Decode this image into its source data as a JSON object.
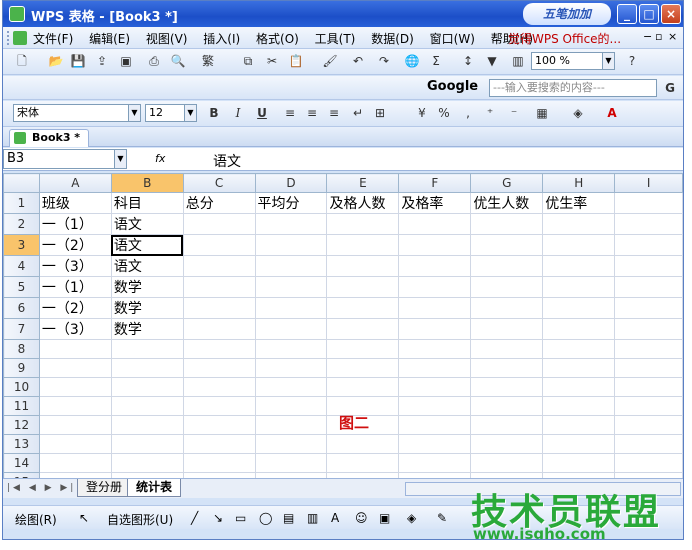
{
  "window": {
    "title": "WPS 表格 - [Book3 *]",
    "logo_text": "五笔加加",
    "buttons": [
      "_",
      "□",
      "×"
    ]
  },
  "menubar": {
    "items": [
      "文件(F)",
      "编辑(E)",
      "视图(V)",
      "插入(I)",
      "格式(O)",
      "工具(T)",
      "数据(D)",
      "窗口(W)",
      "帮助(H)"
    ],
    "promo": "觉得WPS Office的...",
    "mdi_buttons": [
      "−",
      "▫",
      "×"
    ]
  },
  "toolbar_standard": {
    "zoom": "100 %"
  },
  "search": {
    "engine": "Google",
    "placeholder": "---输入要搜索的内容---"
  },
  "toolbar_format": {
    "font": "宋体",
    "size": "12",
    "bold": "B",
    "italic": "I",
    "underline": "U"
  },
  "doc_tab": {
    "label": "Book3 *"
  },
  "formula_bar": {
    "cell_ref": "B3",
    "fx": "fx",
    "value": "语文"
  },
  "grid": {
    "columns": [
      "A",
      "B",
      "C",
      "D",
      "E",
      "F",
      "G",
      "H",
      "I"
    ],
    "rows": [
      [
        "班级",
        "科目",
        "总分",
        "平均分",
        "及格人数",
        "及格率",
        "优生人数",
        "优生率",
        ""
      ],
      [
        "一（1）",
        "语文",
        "",
        "",
        "",
        "",
        "",
        "",
        ""
      ],
      [
        "一（2）",
        "语文",
        "",
        "",
        "",
        "",
        "",
        "",
        ""
      ],
      [
        "一（3）",
        "语文",
        "",
        "",
        "",
        "",
        "",
        "",
        ""
      ],
      [
        "一（1）",
        "数学",
        "",
        "",
        "",
        "",
        "",
        "",
        ""
      ],
      [
        "一（2）",
        "数学",
        "",
        "",
        "",
        "",
        "",
        "",
        ""
      ],
      [
        "一（3）",
        "数学",
        "",
        "",
        "",
        "",
        "",
        "",
        ""
      ],
      [
        "",
        "",
        "",
        "",
        "",
        "",
        "",
        "",
        ""
      ],
      [
        "",
        "",
        "",
        "",
        "",
        "",
        "",
        "",
        ""
      ],
      [
        "",
        "",
        "",
        "",
        "",
        "",
        "",
        "",
        ""
      ],
      [
        "",
        "",
        "",
        "",
        "",
        "",
        "",
        "",
        ""
      ],
      [
        "",
        "",
        "",
        "",
        "",
        "",
        "",
        "",
        ""
      ],
      [
        "",
        "",
        "",
        "",
        "",
        "",
        "",
        "",
        ""
      ],
      [
        "",
        "",
        "",
        "",
        "",
        "",
        "",
        "",
        ""
      ],
      [
        "",
        "",
        "",
        "",
        "",
        "",
        "",
        "",
        ""
      ]
    ],
    "selected_cell": "B3"
  },
  "annotation": "图二",
  "sheets": [
    {
      "label": "登分册",
      "active": false
    },
    {
      "label": "统计表",
      "active": true
    }
  ],
  "drawbar": {
    "draw_label": "绘图(R)",
    "autoshape_label": "自选图形(U)"
  },
  "watermark": {
    "text": "技术员联盟",
    "url": "www.jsgho.com"
  },
  "colors": {
    "title_blue": "#1c4fc8",
    "selected_header": "#f9c46b",
    "annotation_red": "#d01010",
    "watermark_green": "#2aa93a"
  }
}
